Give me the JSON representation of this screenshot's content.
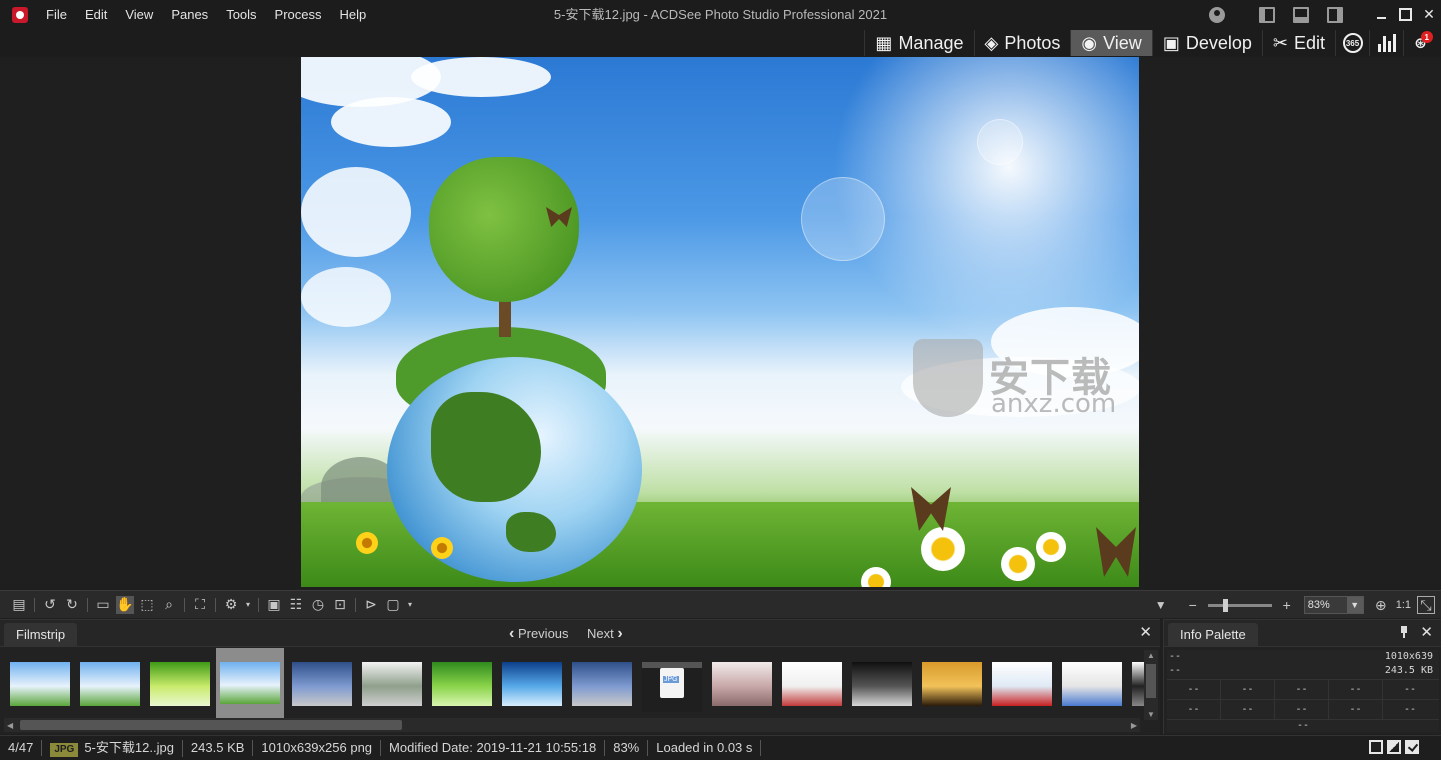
{
  "window": {
    "title": "5-安下载12.jpg - ACDSee Photo Studio Professional 2021",
    "menu": [
      "File",
      "Edit",
      "View",
      "Panes",
      "Tools",
      "Process",
      "Help"
    ],
    "controls": {
      "minimize": "minimize-icon",
      "maximize": "maximize-icon",
      "close": "✕"
    }
  },
  "modes": {
    "tabs": [
      {
        "label": "Manage",
        "icon": "grid-icon",
        "glyph": "▦"
      },
      {
        "label": "Photos",
        "icon": "photos-icon",
        "glyph": "◈"
      },
      {
        "label": "View",
        "icon": "eye-icon",
        "glyph": "◉",
        "active": true
      },
      {
        "label": "Develop",
        "icon": "develop-icon",
        "glyph": "▣"
      },
      {
        "label": "Edit",
        "icon": "edit-brush-icon",
        "glyph": "✂"
      }
    ],
    "badge_365": "365",
    "notification_count": "1"
  },
  "viewer": {
    "watermark": {
      "text": "安下载",
      "url": "anxz.com"
    }
  },
  "zoom": {
    "value": "83%",
    "ratio_label": "1:1",
    "slider_fraction": 0.25
  },
  "filmstrip": {
    "tab": "Filmstrip",
    "previous": "Previous",
    "next": "Next",
    "close": "✕",
    "thumbnails": [
      {
        "type": "globe-sky",
        "selected": false,
        "colors": [
          "#6fb1ef",
          "#e7f2fb",
          "#5aa53a"
        ]
      },
      {
        "type": "globe-sky",
        "selected": false,
        "colors": [
          "#6fb1ef",
          "#e7f2fb",
          "#5aa53a"
        ]
      },
      {
        "type": "dandelion",
        "selected": false,
        "colors": [
          "#3e9a17",
          "#c9eb6b",
          "#e8f7d0"
        ]
      },
      {
        "type": "globe-sky",
        "selected": true,
        "colors": [
          "#6fb1ef",
          "#e7f2fb",
          "#5aa53a"
        ]
      },
      {
        "type": "wolf",
        "selected": false,
        "colors": [
          "#2f4f8a",
          "#7e9ad0",
          "#c9c9c9"
        ]
      },
      {
        "type": "landscape",
        "selected": false,
        "colors": [
          "#f2f2f2",
          "#8fa08c",
          "#cfcfcf"
        ]
      },
      {
        "type": "green-wave",
        "selected": false,
        "colors": [
          "#2f8a1e",
          "#8ad44a",
          "#d9f5b0"
        ]
      },
      {
        "type": "ice",
        "selected": false,
        "colors": [
          "#0d3f8a",
          "#56a9e8",
          "#d8eefc"
        ]
      },
      {
        "type": "wolf",
        "selected": false,
        "colors": [
          "#2f4f8a",
          "#7e9ad0",
          "#c9c9c9"
        ]
      },
      {
        "type": "jpg-file",
        "selected": false,
        "colors": [
          "#1f1f1f",
          "#f4f4f4",
          "#6a9ad8"
        ]
      },
      {
        "type": "portrait",
        "selected": false,
        "colors": [
          "#f2eaea",
          "#c8a8a8",
          "#8a6a6a"
        ]
      },
      {
        "type": "document",
        "selected": false,
        "colors": [
          "#ffffff",
          "#f0f0f0",
          "#c23a3a"
        ]
      },
      {
        "type": "car-night",
        "selected": false,
        "colors": [
          "#101010",
          "#555555",
          "#d8d8d8"
        ]
      },
      {
        "type": "sunset-couple",
        "selected": false,
        "colors": [
          "#d89a2a",
          "#f2c25a",
          "#2a1a0a"
        ]
      },
      {
        "type": "screenshot",
        "selected": false,
        "colors": [
          "#ffffff",
          "#dfe9f5",
          "#c82020"
        ]
      },
      {
        "type": "screenshot-list",
        "selected": false,
        "colors": [
          "#ffffff",
          "#e5e5e5",
          "#4a7ad0"
        ]
      },
      {
        "type": "partial",
        "selected": false,
        "colors": [
          "#ffffff",
          "#222222",
          "#888888"
        ]
      }
    ]
  },
  "info_palette": {
    "tab": "Info Palette",
    "close": "✕",
    "rows": [
      {
        "left": "--",
        "right": "1010x639"
      },
      {
        "left": "--",
        "right": "243.5 KB"
      }
    ],
    "grid": [
      [
        "--",
        "--",
        "--",
        "--",
        "--"
      ],
      [
        "--",
        "--",
        "--",
        "--",
        "--"
      ]
    ],
    "footer": "--"
  },
  "status": {
    "position": "4/47",
    "format": "JPG",
    "filename": "5-安下载12..jpg",
    "filesize": "243.5 KB",
    "dimensions": "1010x639x256 png",
    "modified": "Modified Date: 2019-11-21 10:55:18",
    "zoom": "83%",
    "loaded": "Loaded in 0.03 s"
  }
}
